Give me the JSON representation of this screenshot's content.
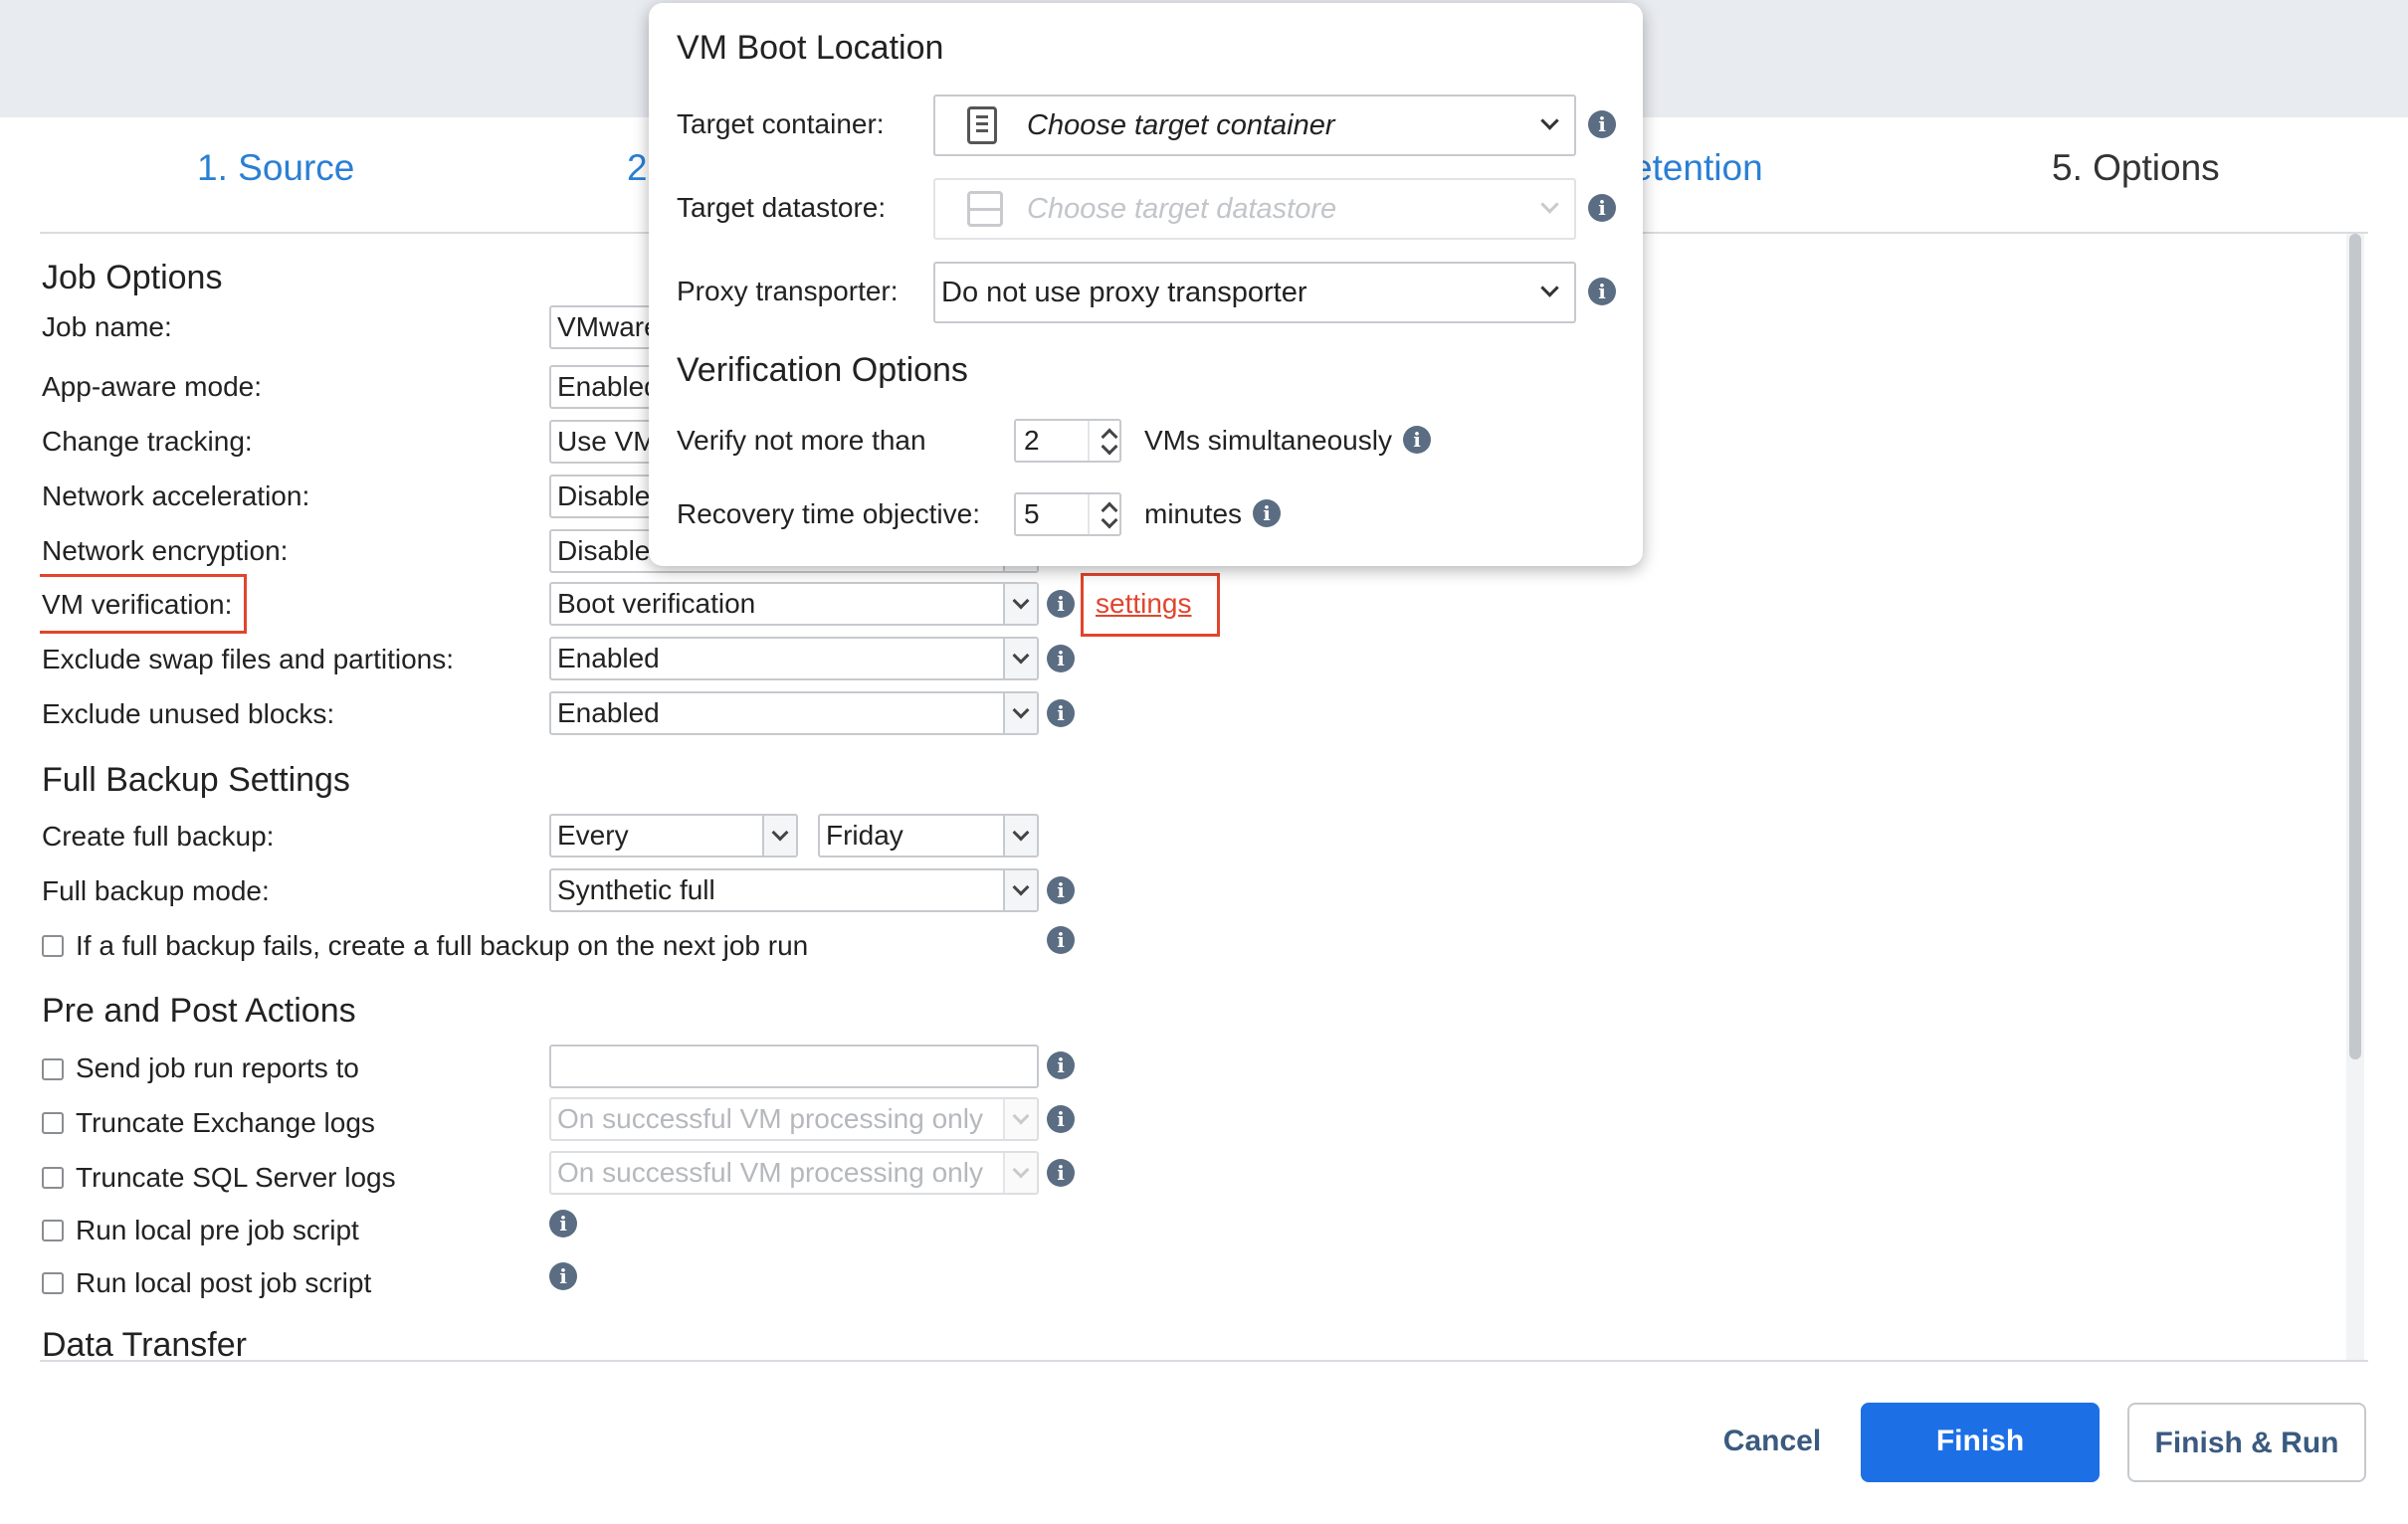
{
  "tabs": {
    "source": "1. Source",
    "step2": "2",
    "retention": "etention",
    "options": "5. Options"
  },
  "job_options": {
    "heading": "Job Options",
    "job_name": {
      "label": "Job name:",
      "value": "VMware"
    },
    "app_aware": {
      "label": "App-aware mode:",
      "value": "Enabled"
    },
    "change_tracking": {
      "label": "Change tracking:",
      "value": "Use VM"
    },
    "net_accel": {
      "label": "Network acceleration:",
      "value": "Disabled"
    },
    "net_enc": {
      "label": "Network encryption:",
      "value": "Disabled"
    },
    "vm_verification": {
      "label": "VM verification:",
      "value": "Boot verification",
      "link": "settings"
    },
    "exclude_swap": {
      "label": "Exclude swap files and partitions:",
      "value": "Enabled"
    },
    "exclude_unused": {
      "label": "Exclude unused blocks:",
      "value": "Enabled"
    }
  },
  "full_backup": {
    "heading": "Full Backup Settings",
    "create": {
      "label": "Create full backup:",
      "freq": "Every",
      "day": "Friday"
    },
    "mode": {
      "label": "Full backup mode:",
      "value": "Synthetic full"
    },
    "fail_check": {
      "label": "If a full backup fails, create a full backup on the next job run"
    }
  },
  "pre_post": {
    "heading": "Pre and Post Actions",
    "reports": {
      "label": "Send job run reports to",
      "value": ""
    },
    "exchange": {
      "label": "Truncate Exchange logs",
      "value": "On successful VM processing only"
    },
    "sql": {
      "label": "Truncate SQL Server logs",
      "value": "On successful VM processing only"
    },
    "pre_script": {
      "label": "Run local pre job script"
    },
    "post_script": {
      "label": "Run local post job script"
    }
  },
  "data_transfer": {
    "heading": "Data Transfer"
  },
  "popup": {
    "title": "VM Boot Location",
    "target_container": {
      "label": "Target container:",
      "value": "Choose target container"
    },
    "target_datastore": {
      "label": "Target datastore:",
      "value": "Choose target datastore"
    },
    "proxy": {
      "label": "Proxy transporter:",
      "value": "Do not use proxy transporter"
    },
    "verification_heading": "Verification Options",
    "verify": {
      "label": "Verify not more than",
      "value": "2",
      "unit": "VMs simultaneously"
    },
    "rto": {
      "label": "Recovery time objective:",
      "value": "5",
      "unit": "minutes"
    }
  },
  "buttons": {
    "cancel": "Cancel",
    "finish": "Finish",
    "finish_run": "Finish & Run"
  },
  "info_glyph": "i",
  "colors": {
    "accent": "#1d6fe6",
    "tab_link": "#2a7fd4",
    "highlight": "#e0452d",
    "info": "#5b6d82"
  }
}
